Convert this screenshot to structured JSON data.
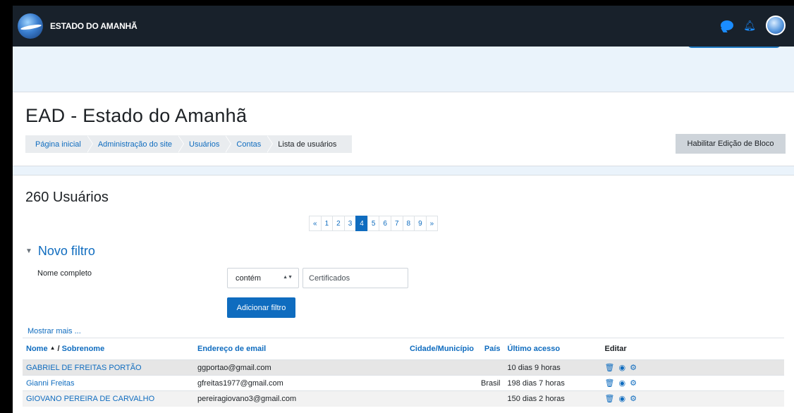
{
  "navbar": {
    "brand": "ESTADO DO AMANHÃ",
    "icons": [
      "message-icon",
      "notification-bell-icon",
      "user-avatar"
    ]
  },
  "header": {
    "title": "EAD - Estado do Amanhã",
    "breadcrumbs": [
      "Página inicial",
      "Administração do site",
      "Usuários",
      "Contas",
      "Lista de usuários"
    ],
    "edit_button": "Habilitar Edição de Bloco"
  },
  "main": {
    "count_heading": "260 Usuários",
    "pagination": [
      "«",
      "1",
      "2",
      "3",
      "4",
      "5",
      "6",
      "7",
      "8",
      "9",
      "»"
    ],
    "active_page": "4",
    "filter": {
      "toggle_label": "Novo filtro",
      "field_label": "Nome completo",
      "operator": "contém",
      "value": "Certificados",
      "add_button": "Adicionar filtro",
      "show_more": "Mostrar mais ..."
    }
  },
  "table": {
    "headers": {
      "name": "Nome",
      "separator": "/",
      "surname": "Sobrenome",
      "email": "Endereço de email",
      "city": "Cidade/Município",
      "country": "País",
      "last_access": "Último acesso",
      "edit": "Editar"
    },
    "rows": [
      {
        "name": "GABRIEL DE FREITAS PORTÃO",
        "email": "ggportao@gmail.com",
        "city": "",
        "country": "",
        "last_access": "10 dias 9 horas"
      },
      {
        "name": "Gianni Freitas",
        "email": "gfreitas1977@gmail.com",
        "city": "",
        "country": "Brasil",
        "last_access": "198 dias 7 horas"
      },
      {
        "name": "GIOVANO PEREIRA DE CARVALHO",
        "email": "pereiragiovano3@gmail.com",
        "city": "",
        "country": "",
        "last_access": "150 dias 2 horas"
      }
    ]
  },
  "colors": {
    "navbar": "#18212b",
    "primary": "#0f6cbf",
    "page_background": "#eaf3fb"
  }
}
